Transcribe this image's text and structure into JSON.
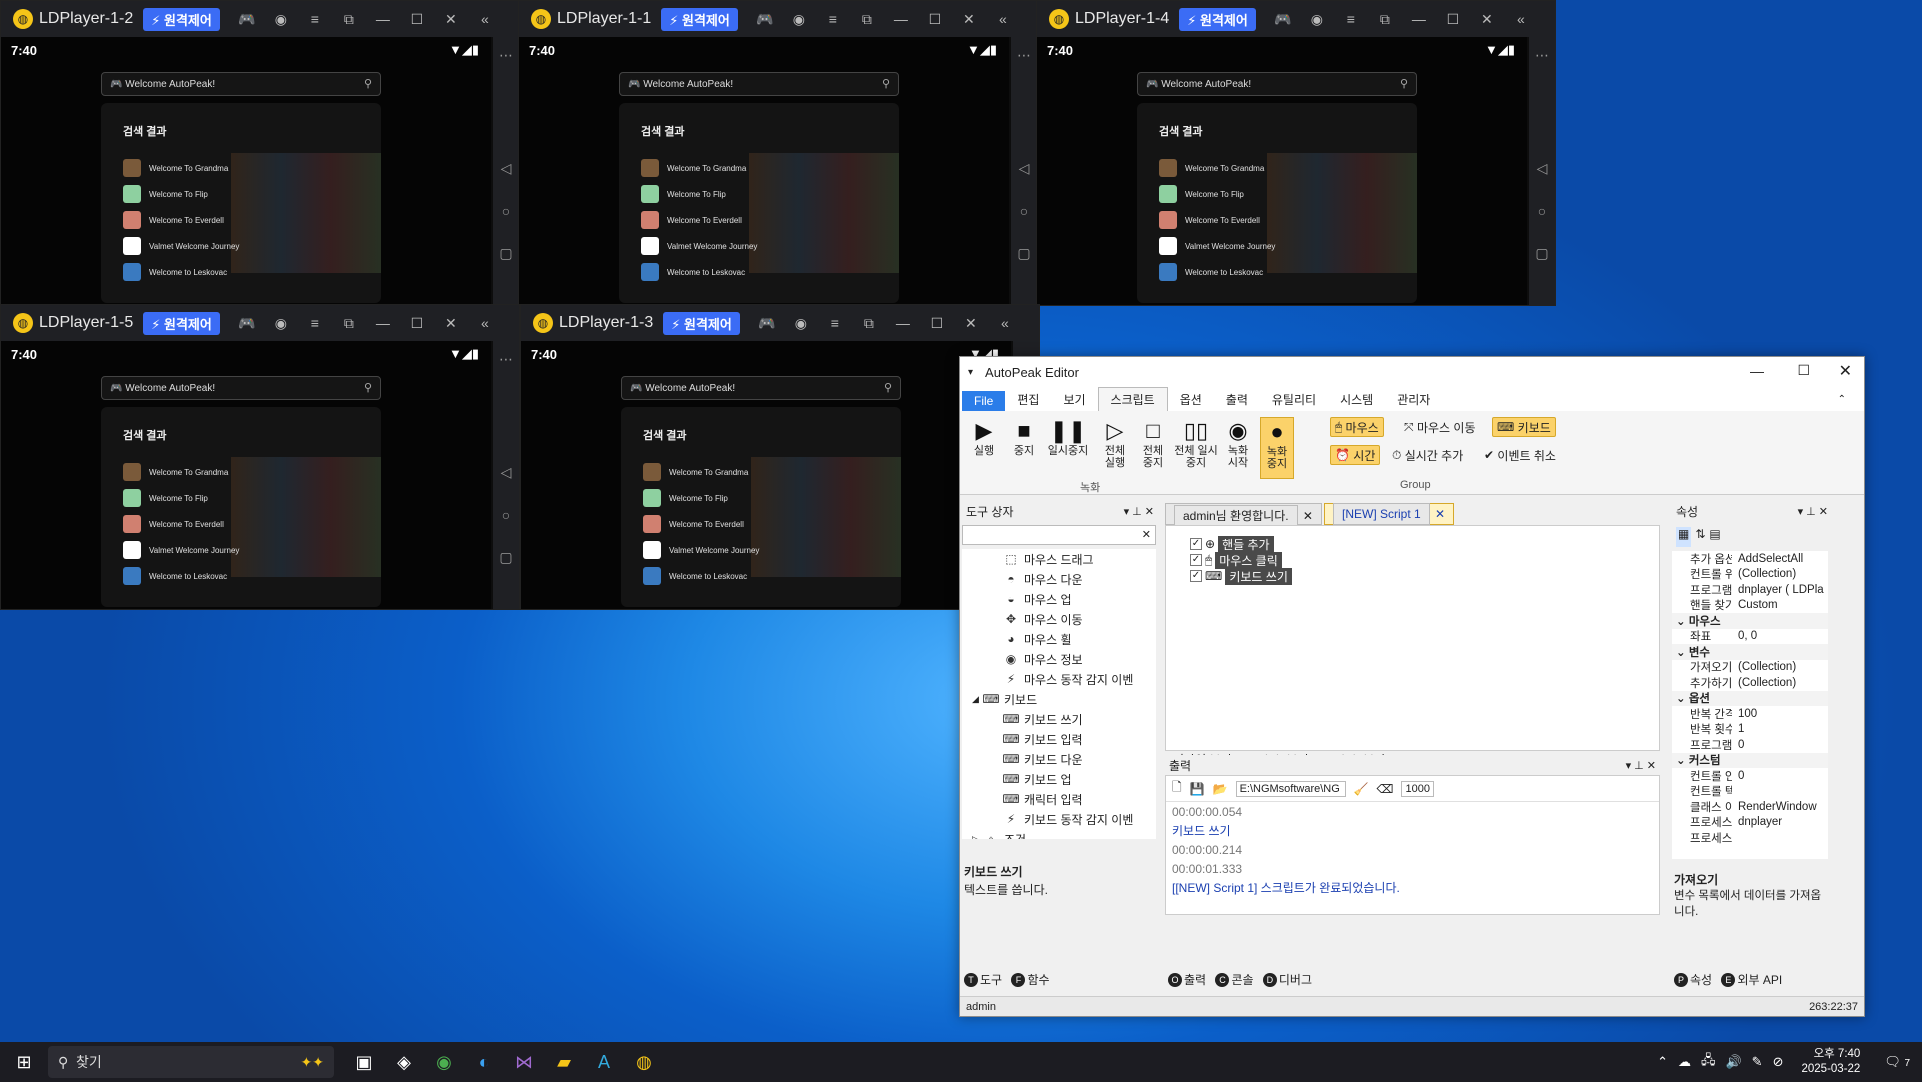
{
  "ld_common": {
    "remote": "원격제어",
    "time": "7:40",
    "search_text": "Welcome AutoPeak!",
    "results_title": "검색 결과",
    "results": [
      "Welcome To Grandma",
      "Welcome To Flip",
      "Welcome To Everdell",
      "Valmet Welcome Journey",
      "Welcome to Leskovac"
    ]
  },
  "ld_windows": [
    "LDPlayer-1-2",
    "LDPlayer-1-1",
    "LDPlayer-1-4",
    "LDPlayer-1-5",
    "LDPlayer-1-3"
  ],
  "editor": {
    "title": "AutoPeak Editor",
    "menu": [
      "File",
      "편집",
      "보기",
      "스크립트",
      "옵션",
      "출력",
      "유틸리티",
      "시스템",
      "관리자"
    ],
    "ribbon": {
      "run": "실행",
      "stop": "중지",
      "pause": "일시중지",
      "all_run": "전체 실행",
      "all_stop": "전체 중지",
      "all_pause": "전체 일시중지",
      "rec_start": "녹화 시작",
      "rec_stop": "녹화 중지",
      "rec_group": "녹화",
      "mouse": "마우스",
      "mouse_move": "마우스 이동",
      "keyboard": "키보드",
      "time": "시간",
      "realtime_add": "실시간 추가",
      "event_cancel": "이벤트 취소",
      "group": "Group"
    },
    "toolbox": {
      "title": "도구 상자",
      "items": [
        "마우스 드래그",
        "마우스 다운",
        "마우스 업",
        "마우스 이동",
        "마우스 휠",
        "마우스 정보",
        "마우스 동작 감지 이벤",
        "키보드",
        "키보드 쓰기",
        "키보드 입력",
        "키보드 다운",
        "키보드 업",
        "캐릭터 입력",
        "키보드 동작 감지 이벤",
        "조건"
      ],
      "desc_title": "키보드 쓰기",
      "desc": "텍스트를 씁니다.",
      "tab_tool": "도구",
      "tab_func": "함수"
    },
    "doc_tabs": [
      "admin님 환영합니다.",
      "[NEW] Script 1"
    ],
    "nodes": [
      "핸들 추가",
      "마우스 클릭",
      "키보드 쓰기"
    ],
    "view_tabs": [
      "디자인 보기",
      "Xml 소스 보기",
      "Json 소스 보기"
    ],
    "output": {
      "title": "출력",
      "path": "E:\\NGMsoftware\\NG",
      "interval": "1000",
      "lines": [
        "00:00:00.054",
        "키보드 쓰기",
        "00:00:00.214",
        "00:00:01.333",
        "[[NEW] Script 1] 스크립트가 완료되었습니다."
      ],
      "tabs": [
        "출력",
        "콘솔",
        "디버그"
      ]
    },
    "props": {
      "title": "속성",
      "rows": [
        [
          "추가 옵션",
          "AddSelectAll"
        ],
        [
          "컨트롤 위",
          "(Collection)"
        ],
        [
          "프로그램",
          "dnplayer ( LDPla"
        ],
        [
          "핸들 찾기",
          "Custom"
        ],
        [
          "마우스",
          ""
        ],
        [
          "좌표",
          "0, 0"
        ],
        [
          "변수",
          ""
        ],
        [
          "가져오기",
          "(Collection)"
        ],
        [
          "추가하기",
          "(Collection)"
        ],
        [
          "옵션",
          ""
        ],
        [
          "반복 간격",
          "100"
        ],
        [
          "반복 횟수",
          "1"
        ],
        [
          "프로그램",
          "0"
        ],
        [
          "커스텀",
          ""
        ],
        [
          "컨트롤 인",
          "0"
        ],
        [
          "컨트롤 텍",
          ""
        ],
        [
          "클래스 이",
          "RenderWindow"
        ],
        [
          "프로세스",
          "dnplayer"
        ],
        [
          "프로세스",
          ""
        ]
      ],
      "desc_title": "가져오기",
      "desc": "변수 목록에서 데이터를 가져옵니다.",
      "tab_prop": "속성",
      "tab_api": "외부 API"
    },
    "status_user": "admin",
    "status_time": "263:22:37"
  },
  "taskbar": {
    "search": "찾기",
    "ampm": "오후 7:40",
    "date": "2025-03-22",
    "notif": "7"
  }
}
